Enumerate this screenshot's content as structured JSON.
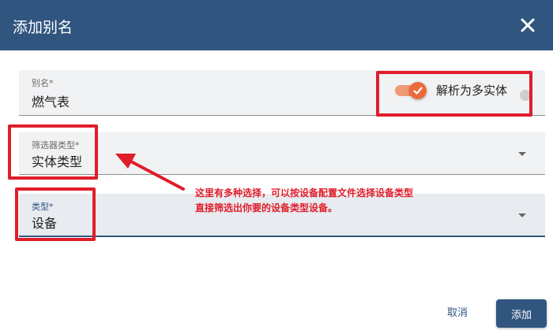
{
  "dialog": {
    "title": "添加别名"
  },
  "alias_field": {
    "label": "别名*",
    "value": "燃气表"
  },
  "resolve_toggle": {
    "label": "解析为多实体",
    "checked": true
  },
  "filter_type_field": {
    "label": "筛选器类型*",
    "value": "实体类型"
  },
  "type_field": {
    "label": "类型*",
    "value": "设备"
  },
  "annotation": {
    "line1": "这里有多种选择，可以按设备配置文件选择设备类型",
    "line2": "直接筛选出你要的设备类型设备。"
  },
  "actions": {
    "cancel_label": "取消",
    "add_label": "添加"
  },
  "colors": {
    "header": "#305680",
    "accent": "#ee6a3c",
    "annotation_red": "#e01d2a"
  }
}
